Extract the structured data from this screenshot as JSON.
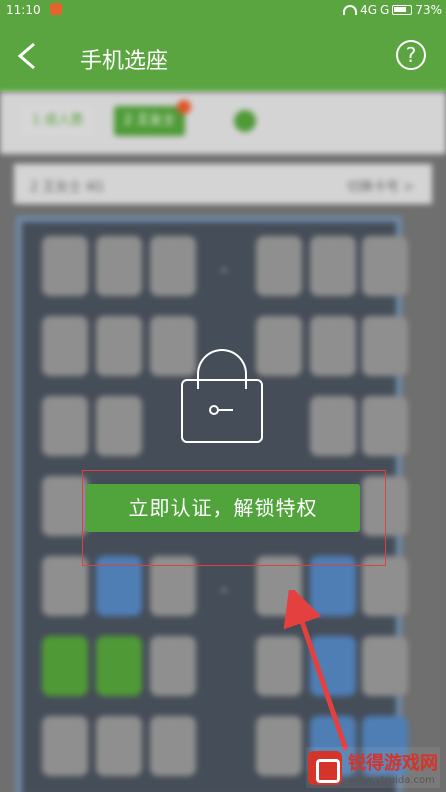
{
  "status": {
    "time": "11:10",
    "network": "4G",
    "network2": "G",
    "battery": "73%"
  },
  "header": {
    "title": "手机选座"
  },
  "background": {
    "tabs": [
      "1 成人票",
      "2 王女士"
    ],
    "train_left": "2 王女士 4G",
    "train_right": "切换卡号 >"
  },
  "overlay": {
    "verify_button": "立即认证，解锁特权"
  },
  "watermark": {
    "title": "锐得游戏网",
    "url": "www.ytruida.com"
  },
  "colors": {
    "brand": "#5aa540",
    "button": "#51a33c",
    "highlight": "#e04040"
  },
  "icons": {
    "back": "back-arrow-icon",
    "help": "question-mark-icon",
    "lock": "padlock-icon"
  }
}
